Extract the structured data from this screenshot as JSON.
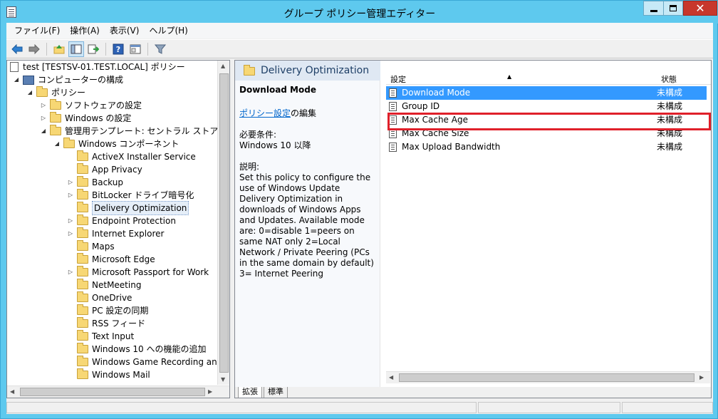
{
  "window": {
    "title": "グループ ポリシー管理エディター"
  },
  "menu": [
    "ファイル(F)",
    "操作(A)",
    "表示(V)",
    "ヘルプ(H)"
  ],
  "toolbar": {
    "icons": [
      "back-arrow-icon",
      "forward-arrow-icon",
      "up-folder-icon",
      "show-hide-tree-icon",
      "export-list-icon",
      "help-icon",
      "properties-icon",
      "filter-icon"
    ]
  },
  "tree": {
    "root": "test [TESTSV-01.TEST.LOCAL] ポリシー",
    "computer_config": "コンピューターの構成",
    "policies": "ポリシー",
    "software_settings": "ソフトウェアの設定",
    "windows_settings": "Windows の設定",
    "admin_templates": "管理用テンプレート: セントラル ストアから取得",
    "windows_components": "Windows コンポーネント",
    "components": [
      {
        "label": "ActiveX Installer Service",
        "expander": ""
      },
      {
        "label": "App Privacy",
        "expander": ""
      },
      {
        "label": "Backup",
        "expander": "▷"
      },
      {
        "label": "BitLocker ドライブ暗号化",
        "expander": "▷"
      },
      {
        "label": "Delivery Optimization",
        "expander": ""
      },
      {
        "label": "Endpoint Protection",
        "expander": "▷"
      },
      {
        "label": "Internet Explorer",
        "expander": "▷"
      },
      {
        "label": "Maps",
        "expander": ""
      },
      {
        "label": "Microsoft Edge",
        "expander": ""
      },
      {
        "label": "Microsoft Passport for Work",
        "expander": "▷"
      },
      {
        "label": "NetMeeting",
        "expander": ""
      },
      {
        "label": "OneDrive",
        "expander": ""
      },
      {
        "label": "PC 設定の同期",
        "expander": ""
      },
      {
        "label": "RSS フィード",
        "expander": ""
      },
      {
        "label": "Text Input",
        "expander": ""
      },
      {
        "label": "Windows 10 への機能の追加",
        "expander": ""
      },
      {
        "label": "Windows Game Recording and",
        "expander": ""
      },
      {
        "label": "Windows Mail",
        "expander": ""
      }
    ],
    "selected": "Delivery Optimization"
  },
  "right": {
    "header": "Delivery Optimization",
    "desc_title": "Download Mode",
    "edit_link": "ポリシー設定",
    "edit_suffix": "の編集",
    "req_label": "必要条件:",
    "req_value": "Windows 10 以降",
    "expl_label": "説明:",
    "expl_text": "Set this policy to configure the use of Windows Update Delivery Optimization in downloads of Windows Apps and Updates. Available mode are: 0=disable 1=peers on same NAT only 2=Local Network / Private Peering (PCs in the same domain by default) 3= Internet Peering",
    "col_setting": "設定",
    "col_state": "状態",
    "rows": [
      {
        "name": "Download Mode",
        "state": "未構成"
      },
      {
        "name": "Group ID",
        "state": "未構成"
      },
      {
        "name": "Max Cache Age",
        "state": "未構成"
      },
      {
        "name": "Max Cache Size",
        "state": "未構成"
      },
      {
        "name": "Max Upload Bandwidth",
        "state": "未構成"
      }
    ],
    "tabs": [
      "拡張",
      "標準"
    ]
  }
}
